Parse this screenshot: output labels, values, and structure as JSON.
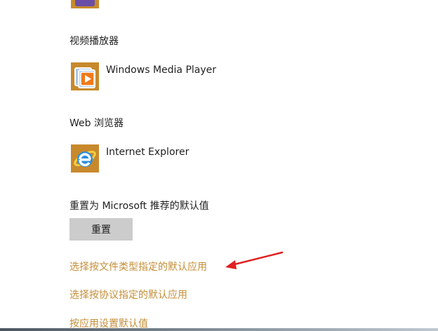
{
  "video_player": {
    "heading": "视频播放器",
    "app_name": "Windows Media Player",
    "icon": "windows-media-player-icon"
  },
  "web_browser": {
    "heading": "Web 浏览器",
    "app_name": "Internet Explorer",
    "icon": "internet-explorer-icon"
  },
  "reset": {
    "heading": "重置为 Microsoft 推荐的默认值",
    "button_label": "重置"
  },
  "links": {
    "by_file_type": "选择按文件类型指定的默认应用",
    "by_protocol": "选择按协议指定的默认应用",
    "by_app": "按应用设置默认值"
  },
  "colors": {
    "tile_background": "#c8892c",
    "link": "#c48e38",
    "button": "#cccccc",
    "annotation_arrow": "#e02020"
  }
}
